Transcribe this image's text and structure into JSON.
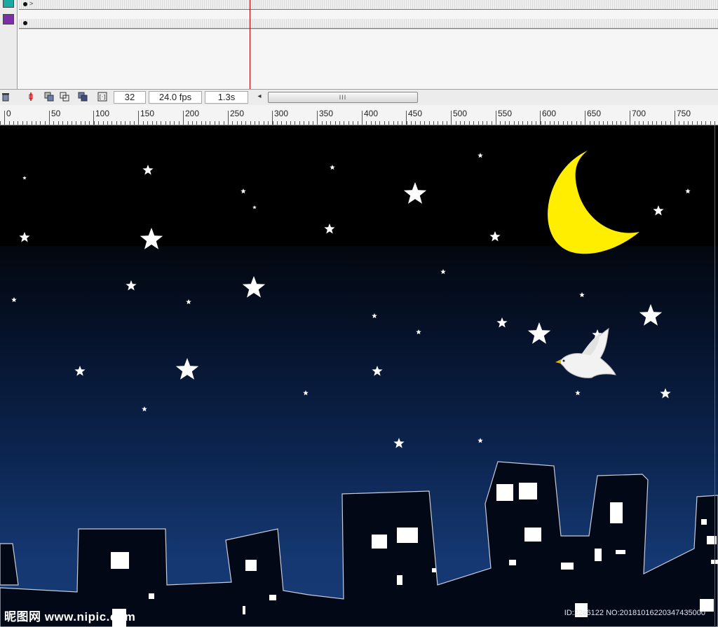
{
  "timeline": {
    "layers": [
      {
        "name_color": "#1aa9a3"
      },
      {
        "name_color": "#7b2fa8"
      }
    ],
    "current_frame": "32",
    "frame_rate": "24.0 fps",
    "elapsed_time": "1.3s"
  },
  "toolbar": {
    "icons": [
      "trash-icon",
      "center-frame-icon",
      "onion-skin-icon",
      "onion-skin-outlines-icon",
      "edit-multiple-frames-icon",
      "modify-onion-markers-icon"
    ],
    "scroll_thumb": "III"
  },
  "ruler": {
    "labels": [
      "0",
      "50",
      "100",
      "150",
      "200",
      "250",
      "300",
      "350",
      "400",
      "450",
      "500",
      "550",
      "600",
      "650",
      "700",
      "750"
    ]
  },
  "stage": {
    "colors": {
      "moon": "#ffee00",
      "star": "#ffffff",
      "building": "#020816",
      "window": "#ffffff",
      "sky_top": "#000000",
      "sky_bottom": "#163a74"
    },
    "elements": [
      "crescent-moon",
      "stars",
      "white-dove",
      "city-skyline"
    ]
  },
  "watermark": {
    "logo": "昵图网 www.nipic.com",
    "id": "ID:22c6122 NO:20181016220347435000"
  }
}
